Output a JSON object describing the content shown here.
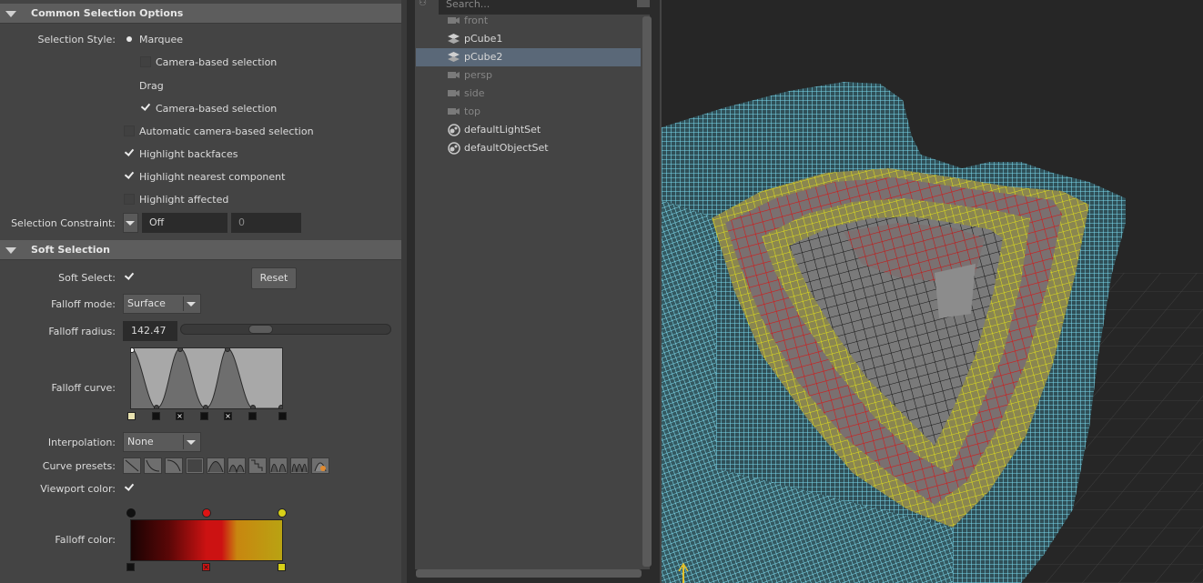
{
  "attribute_editor": {
    "common_section": {
      "title": "Common Selection Options",
      "selection_style_label": "Selection Style:",
      "marquee_label": "Marquee",
      "marquee_camera_label": "Camera-based selection",
      "drag_label": "Drag",
      "drag_camera_label": "Camera-based selection",
      "auto_camera_label": "Automatic camera-based selection",
      "highlight_backfaces_label": "Highlight backfaces",
      "highlight_nearest_label": "Highlight nearest component",
      "highlight_affected_label": "Highlight affected",
      "constraint_label": "Selection Constraint:",
      "constraint_value": "Off",
      "constraint_number": "0"
    },
    "soft_section": {
      "title": "Soft Selection",
      "soft_select_label": "Soft Select:",
      "reset_label": "Reset",
      "falloff_mode_label": "Falloff mode:",
      "falloff_mode_value": "Surface",
      "falloff_radius_label": "Falloff radius:",
      "falloff_radius_value": "142.47",
      "falloff_curve_label": "Falloff curve:",
      "interpolation_label": "Interpolation:",
      "interpolation_value": "None",
      "curve_presets_label": "Curve presets:",
      "viewport_color_label": "Viewport color:",
      "falloff_color_label": "Falloff color:"
    }
  },
  "outliner": {
    "search_placeholder": "Search...",
    "items": [
      {
        "label": "front",
        "icon": "camera-icon",
        "dim": true
      },
      {
        "label": "pCube1",
        "icon": "mesh-icon",
        "dim": false
      },
      {
        "label": "pCube2",
        "icon": "mesh-icon",
        "dim": false,
        "selected": true
      },
      {
        "label": "persp",
        "icon": "camera-icon",
        "dim": true
      },
      {
        "label": "side",
        "icon": "camera-icon",
        "dim": true
      },
      {
        "label": "top",
        "icon": "camera-icon",
        "dim": true
      },
      {
        "label": "defaultLightSet",
        "icon": "set-icon",
        "dim": false
      },
      {
        "label": "defaultObjectSet",
        "icon": "set-icon",
        "dim": false
      }
    ]
  },
  "colors": {
    "panel_bg": "#444444",
    "header_bg": "#5d5d5d",
    "selection_highlight": "#5a6878",
    "viewport_bg": "#262626",
    "wire_cyan": "#7ad8ec",
    "wire_red": "#d01a1a",
    "wire_yellow": "#d8d818"
  }
}
